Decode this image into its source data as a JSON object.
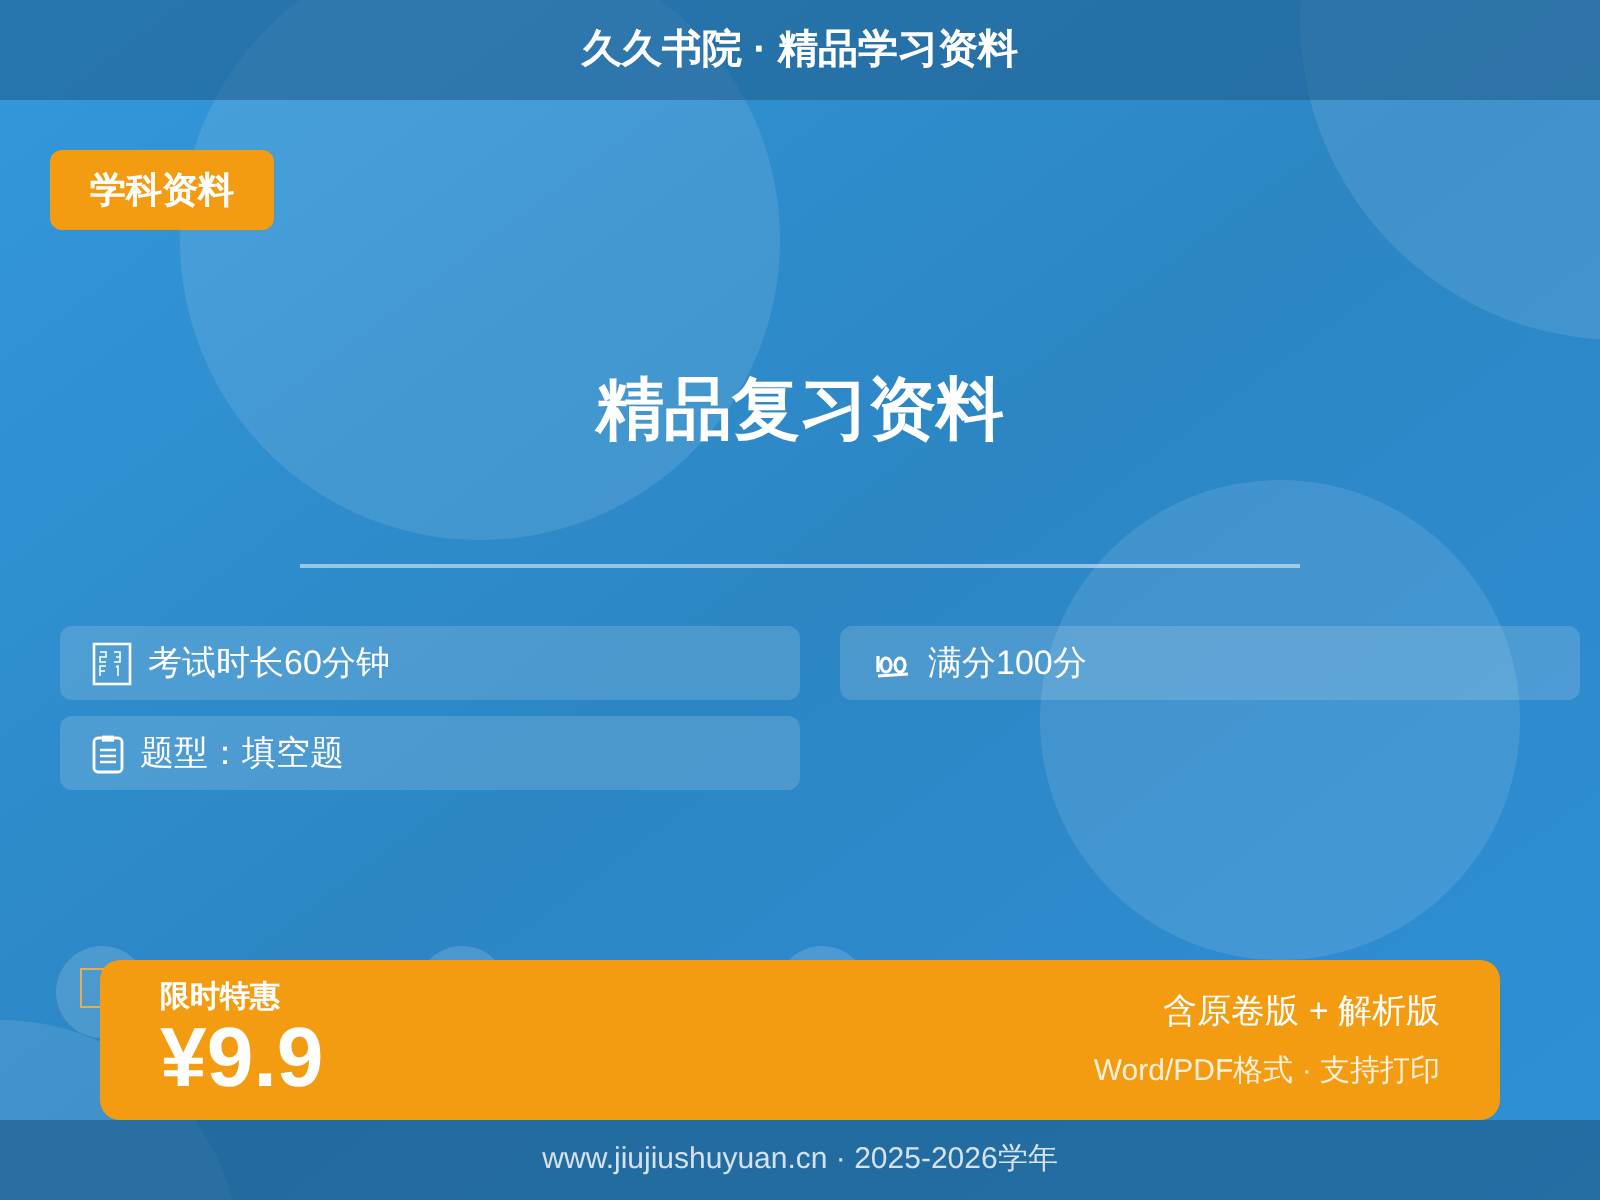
{
  "header": {
    "title": "久久书院 · 精品学习资料"
  },
  "badge": "学科资料",
  "title": "精品复习资料",
  "info": [
    {
      "text": "考试时长60分钟"
    },
    {
      "text": "满分100分"
    },
    {
      "text": "题型：填空题"
    }
  ],
  "price_bar": {
    "label": "限时特惠",
    "price": "¥9.9",
    "line_1": "含原卷版 + 解析版",
    "line_2": "Word/PDF格式 · 支持打印"
  },
  "footer": "www.jiujiushuyuan.cn · 2025-2026学年"
}
